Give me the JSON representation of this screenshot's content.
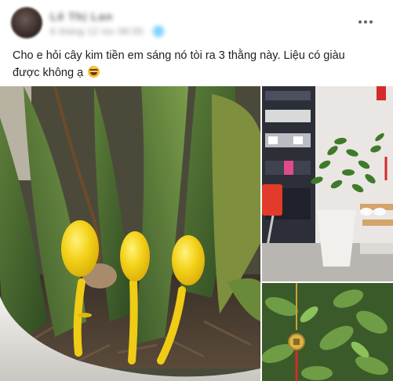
{
  "post": {
    "author_name": "Lê Thị Lan",
    "meta_text": "6 tháng 12 lúc 08:05 · 🌐",
    "body_line1": "Cho e hỏi cây kim tiền em sáng nó tòi ra 3 thằng này.  Liệu có giàu",
    "body_line2": "được không ạ",
    "emoji_icon": "rofl-emoji-icon"
  },
  "header": {
    "more_icon": "more-options-icon"
  },
  "photos": [
    {
      "name": "photo-main",
      "subject": "yellow-mushrooms-in-pot"
    },
    {
      "name": "photo-room",
      "subject": "zz-plant-in-room"
    },
    {
      "name": "photo-closeup",
      "subject": "zz-plant-with-charm"
    }
  ],
  "colors": {
    "mushroom_yellow": "#f4d21a",
    "pot_white": "#eceae6",
    "leaf_green": "#4a6d36",
    "text": "#1c1e21"
  }
}
